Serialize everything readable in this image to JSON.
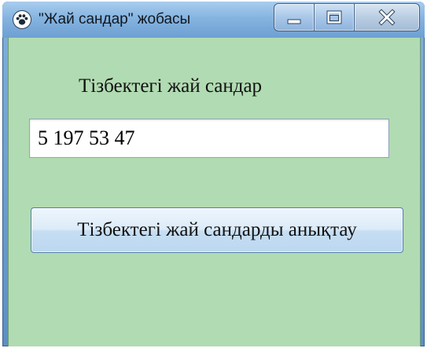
{
  "window": {
    "title": "\"Жай сандар\" жобасы",
    "app_icon": "paw-icon",
    "controls": {
      "minimize_icon": "minimize-icon",
      "maximize_icon": "maximize-icon",
      "close_icon": "close-icon"
    }
  },
  "form": {
    "label": "Тізбектегі жай сандар",
    "input_value": "5 197 53 47",
    "button_label": "Тізбектегі жай сандарды анықтау"
  },
  "colors": {
    "form_background": "#b1dbb2",
    "title_bar": "#86b4e0",
    "button_face": "#dcebf8"
  }
}
